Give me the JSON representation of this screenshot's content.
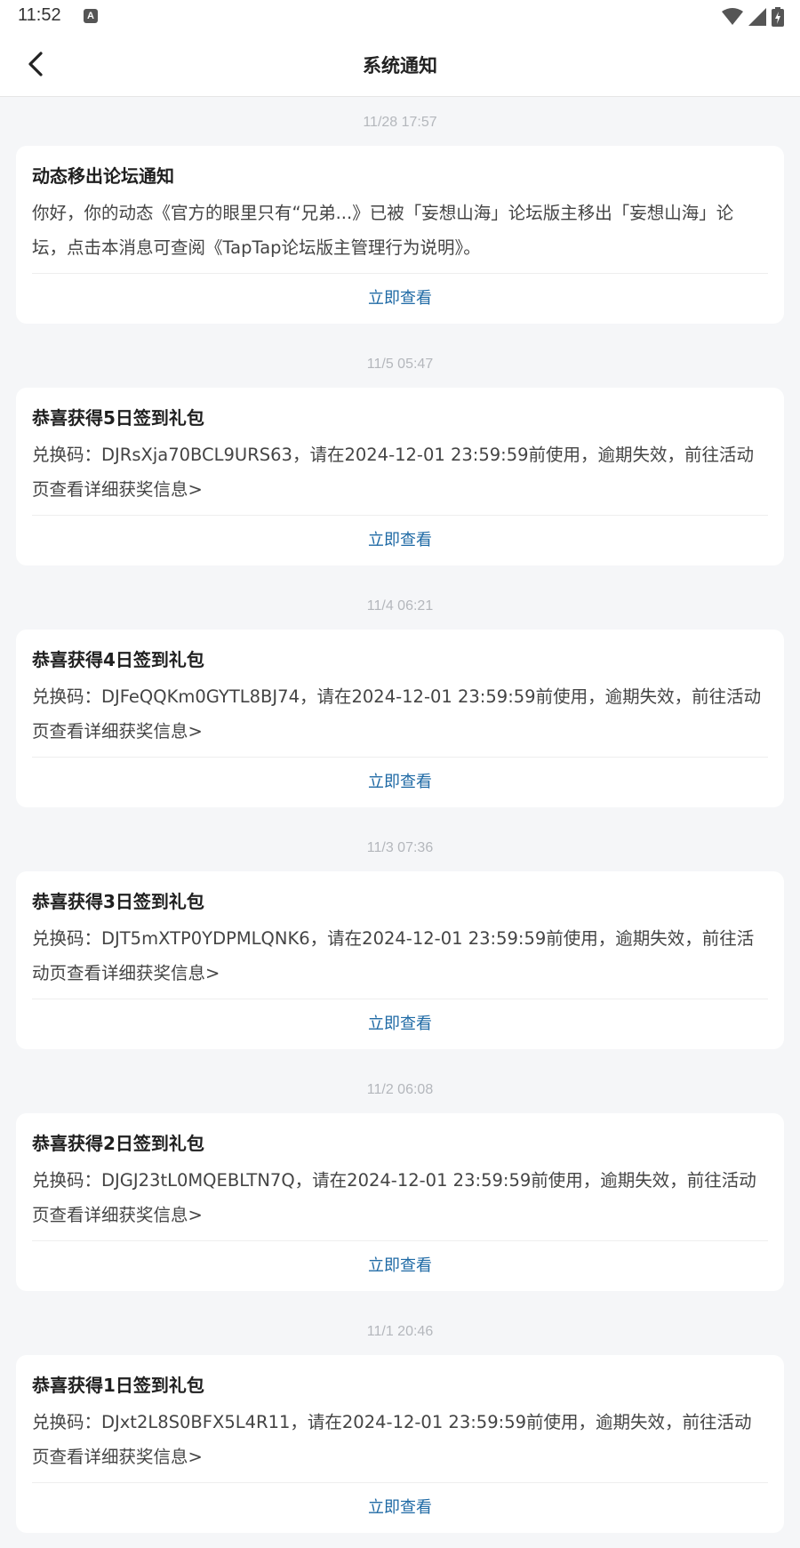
{
  "status_bar": {
    "time": "11:52",
    "input_indicator": "A",
    "icons": [
      "wifi-icon",
      "signal-icon",
      "battery-icon"
    ]
  },
  "header": {
    "title": "系统通知",
    "back_icon": "chevron-left-icon"
  },
  "colors": {
    "link": "#1f6aa5",
    "background": "#f5f6f8",
    "card": "#ffffff",
    "timestamp": "#b4b7bc"
  },
  "notifications": [
    {
      "time": "11/28  17:57",
      "title": "动态移出论坛通知",
      "body": "你好，你的动态《官方的眼里只有“兄弟...》已被「妄想山海」论坛版主移出「妄想山海」论坛，点击本消息可查阅《TapTap论坛版主管理行为说明》。",
      "action": "立即查看"
    },
    {
      "time": "11/5  05:47",
      "title": "恭喜获得5日签到礼包",
      "body": "兑换码：DJRsXja70BCL9URS63，请在2024-12-01 23:59:59前使用，逾期失效，前往活动页查看详细获奖信息>",
      "action": "立即查看"
    },
    {
      "time": "11/4  06:21",
      "title": "恭喜获得4日签到礼包",
      "body": "兑换码：DJFeQQKm0GYTL8BJ74，请在2024-12-01 23:59:59前使用，逾期失效，前往活动页查看详细获奖信息>",
      "action": "立即查看"
    },
    {
      "time": "11/3  07:36",
      "title": "恭喜获得3日签到礼包",
      "body": "兑换码：DJT5mXTP0YDPMLQNK6，请在2024-12-01 23:59:59前使用，逾期失效，前往活动页查看详细获奖信息>",
      "action": "立即查看"
    },
    {
      "time": "11/2  06:08",
      "title": "恭喜获得2日签到礼包",
      "body": "兑换码：DJGJ23tL0MQEBLTN7Q，请在2024-12-01 23:59:59前使用，逾期失效，前往活动页查看详细获奖信息>",
      "action": "立即查看"
    },
    {
      "time": "11/1  20:46",
      "title": "恭喜获得1日签到礼包",
      "body": "兑换码：DJxt2L8S0BFX5L4R11，请在2024-12-01 23:59:59前使用，逾期失效，前往活动页查看详细获奖信息>",
      "action": "立即查看"
    }
  ]
}
